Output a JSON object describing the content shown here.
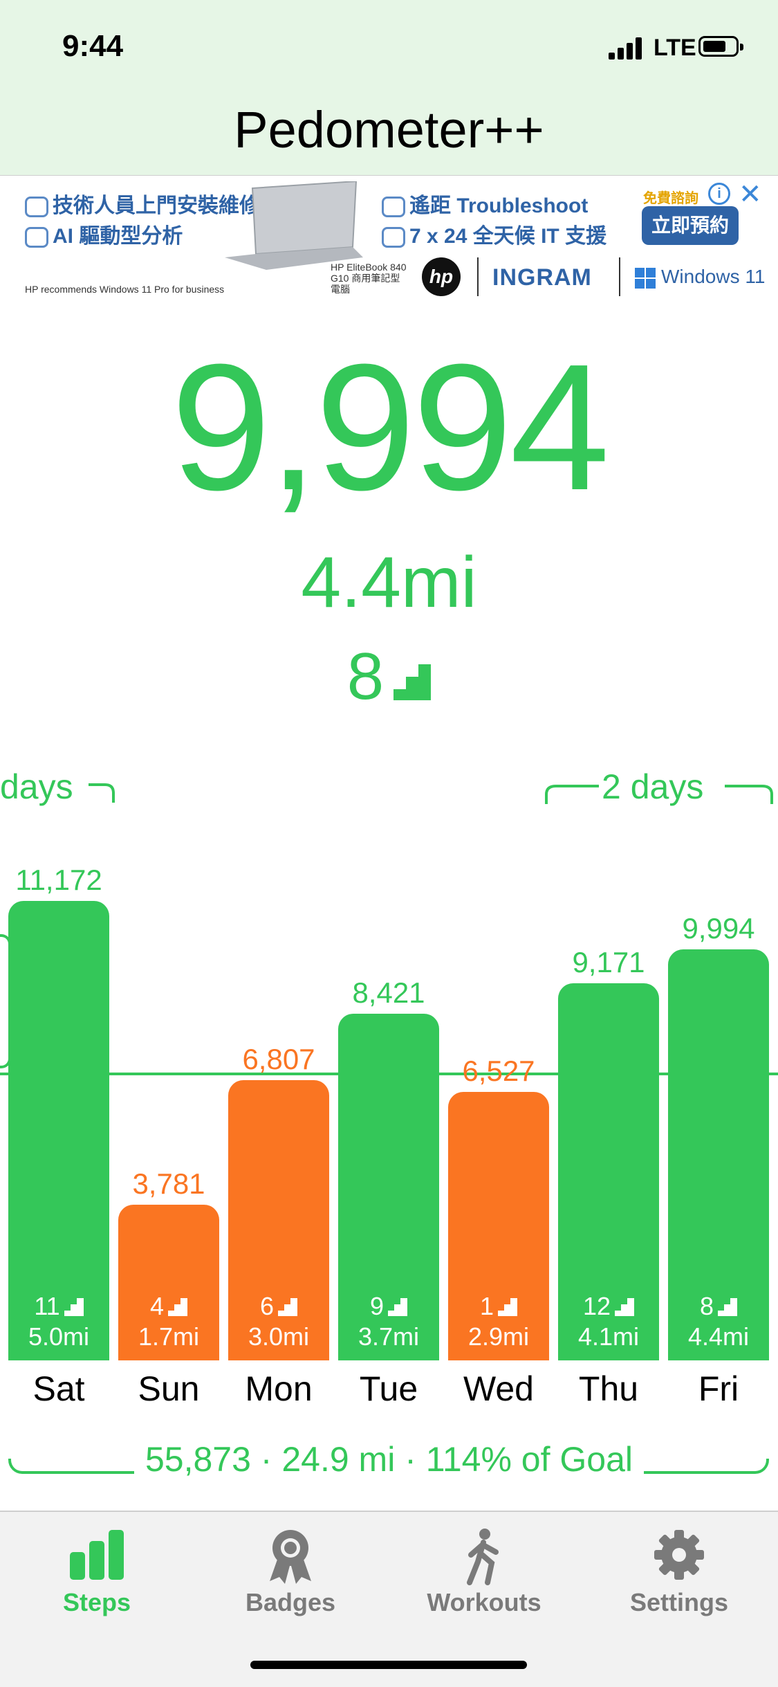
{
  "status_bar": {
    "time": "9:44",
    "network": "LTE"
  },
  "app": {
    "title": "Pedometer++"
  },
  "ad": {
    "line1": "技術人員上門安裝維修",
    "line2": "AI 驅動型分析",
    "line3": "遙距 Troubleshoot",
    "line4": "7 x 24 全天候 IT 支援",
    "free_tag": "免費諮詢",
    "cta": "立即預約",
    "footnote": "HP recommends Windows 11 Pro for business",
    "model": "HP EliteBook 840 G10 商用筆記型電腦",
    "hp": "hp",
    "ingram": "INGRAM",
    "windows": "Windows 11"
  },
  "today": {
    "steps": "9,994",
    "distance": "4.4mi",
    "floors": "8"
  },
  "streak": {
    "left_label": "days",
    "right_label": "2 days"
  },
  "chart_data": {
    "type": "bar",
    "categories": [
      "Sat",
      "Sun",
      "Mon",
      "Tue",
      "Wed",
      "Thu",
      "Fri"
    ],
    "values": [
      11172,
      3781,
      6807,
      8421,
      6527,
      9171,
      9994
    ],
    "value_labels": [
      "11,172",
      "3,781",
      "6,807",
      "8,421",
      "6,527",
      "9,171",
      "9,994"
    ],
    "floors": [
      "11",
      "4",
      "6",
      "9",
      "1",
      "12",
      "8"
    ],
    "distances": [
      "5.0mi",
      "1.7mi",
      "3.0mi",
      "3.7mi",
      "2.9mi",
      "4.1mi",
      "4.4mi"
    ],
    "goal_met": [
      true,
      false,
      false,
      true,
      false,
      true,
      true
    ],
    "goal": 7000,
    "ylim": [
      0,
      11500
    ],
    "colors": {
      "met": "#34c759",
      "missed": "#fa7522"
    }
  },
  "summary": {
    "text": "55,873 · 24.9 mi · 114% of Goal"
  },
  "tabs": [
    {
      "label": "Steps",
      "icon": "bars-icon",
      "active": true
    },
    {
      "label": "Badges",
      "icon": "badge-icon",
      "active": false
    },
    {
      "label": "Workouts",
      "icon": "walker-icon",
      "active": false
    },
    {
      "label": "Settings",
      "icon": "gear-icon",
      "active": false
    }
  ]
}
